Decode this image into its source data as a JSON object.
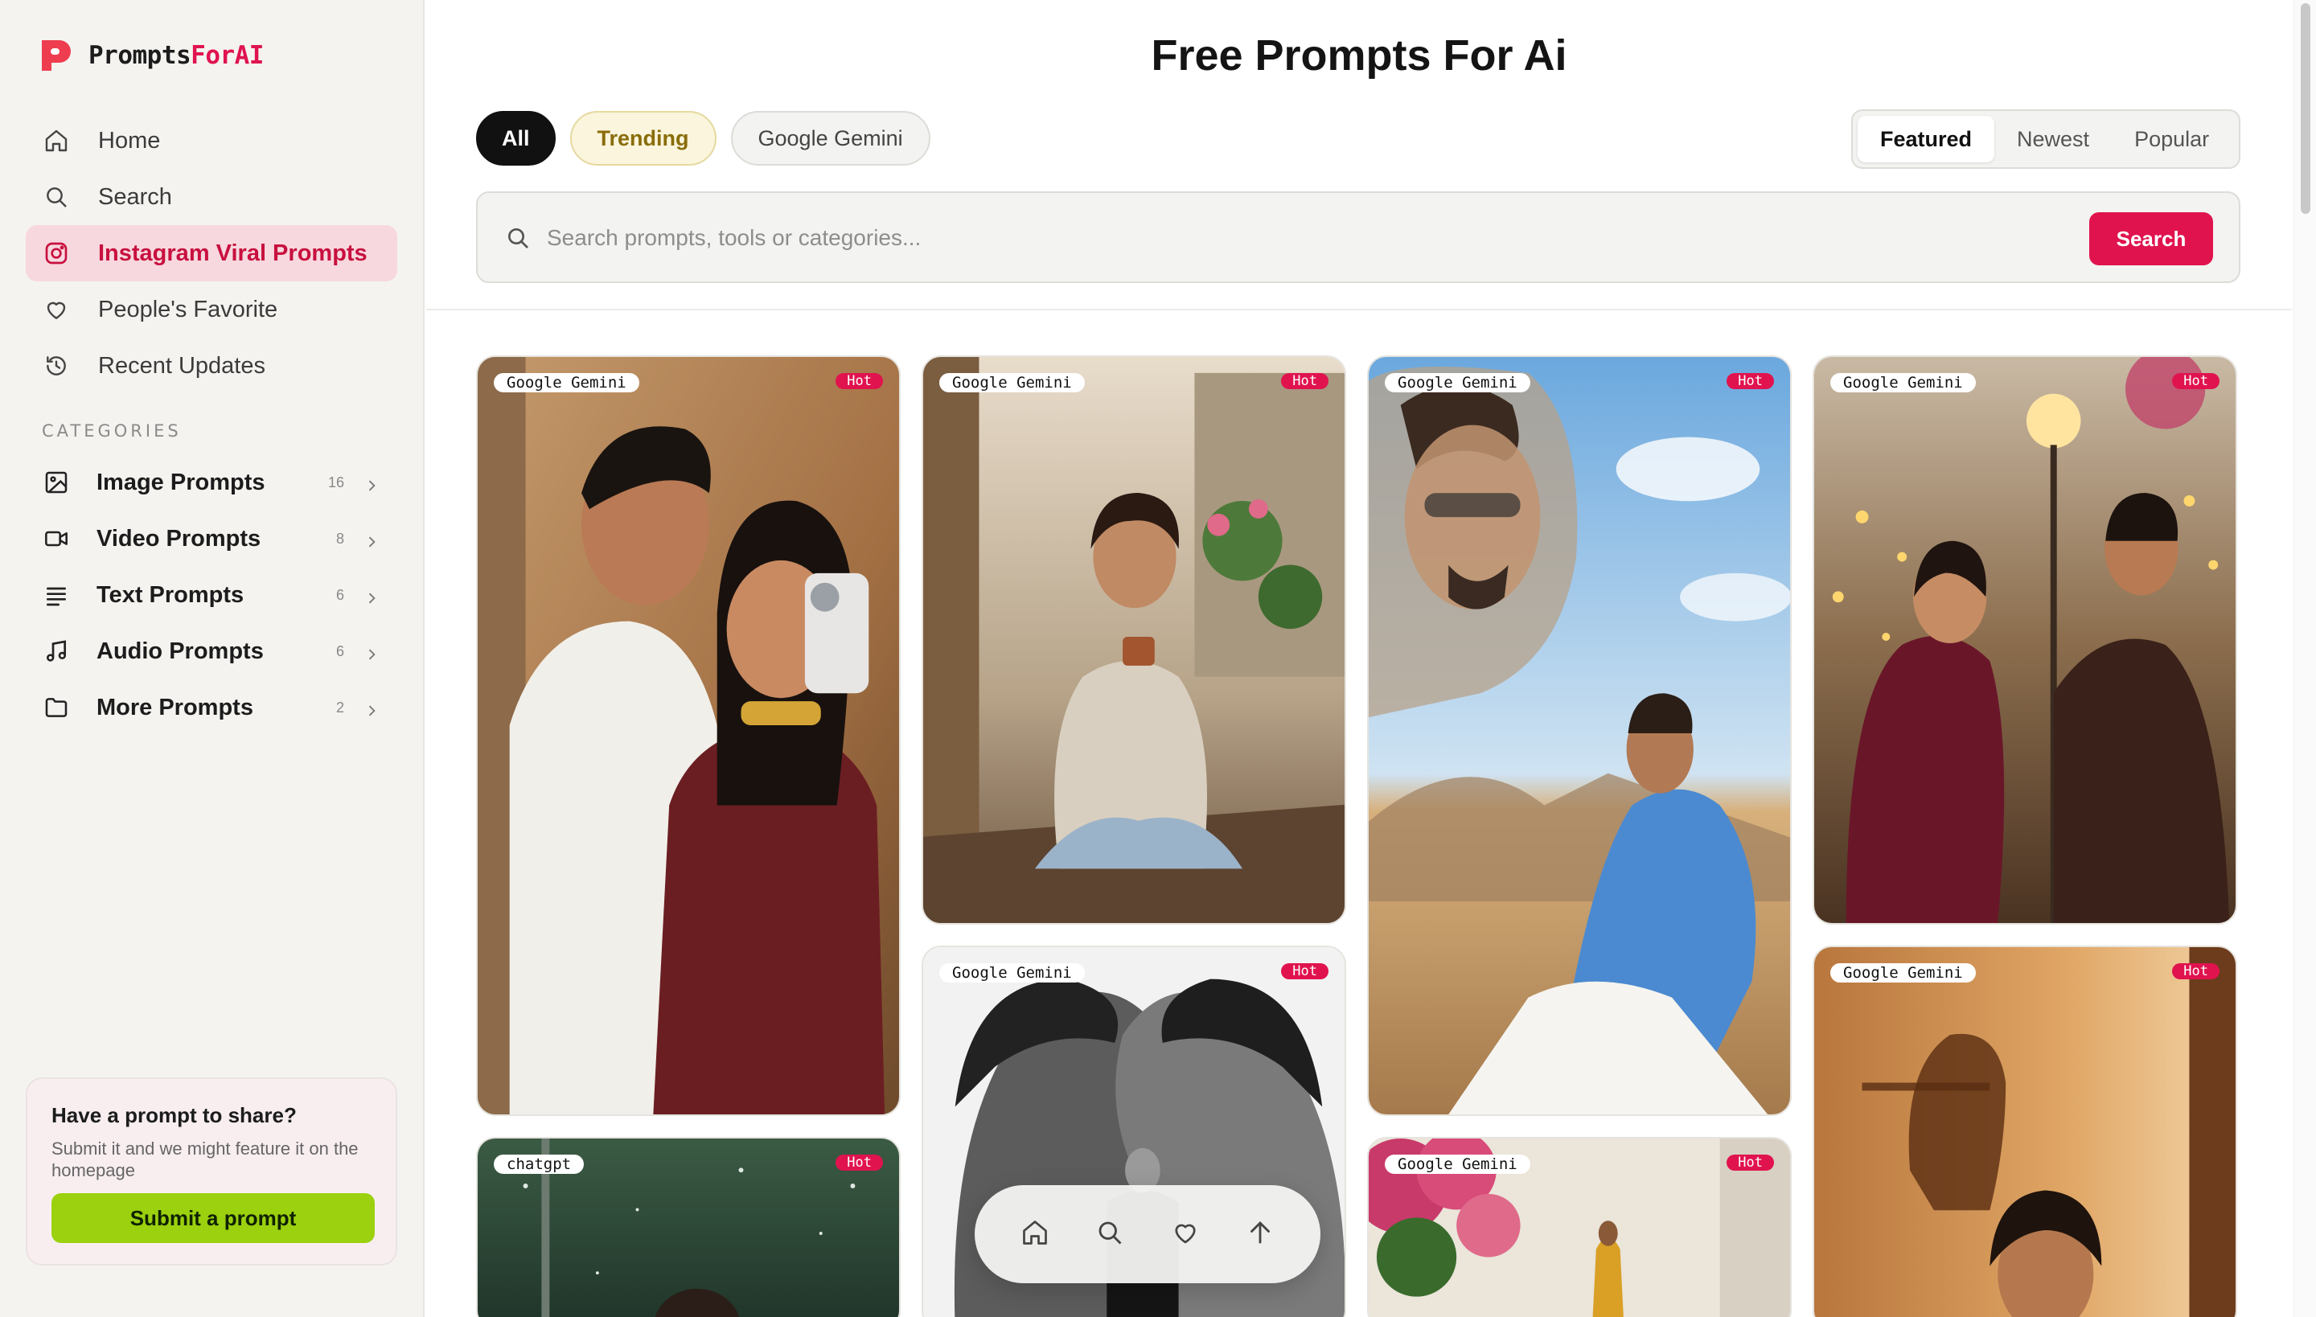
{
  "brand": {
    "name_part1": "Prompts",
    "name_part2": "ForAI",
    "accent_color": "#e0134f"
  },
  "nav": [
    {
      "label": "Home",
      "icon": "home-icon"
    },
    {
      "label": "Search",
      "icon": "search-icon"
    },
    {
      "label": "Instagram Viral Prompts",
      "icon": "instagram-icon",
      "active": true
    },
    {
      "label": "People's Favorite",
      "icon": "heart-icon"
    },
    {
      "label": "Recent Updates",
      "icon": "history-icon"
    }
  ],
  "categories_title": "CATEGORIES",
  "categories": [
    {
      "label": "Image Prompts",
      "count": "16",
      "icon": "image-icon"
    },
    {
      "label": "Video Prompts",
      "count": "8",
      "icon": "video-icon"
    },
    {
      "label": "Text Prompts",
      "count": "6",
      "icon": "text-lines-icon"
    },
    {
      "label": "Audio Prompts",
      "count": "6",
      "icon": "music-note-icon"
    },
    {
      "label": "More Prompts",
      "count": "2",
      "icon": "folder-icon"
    }
  ],
  "share": {
    "title": "Have a prompt to share?",
    "description": "Submit it and we might feature it on the homepage",
    "button": "Submit a prompt",
    "button_color": "#9bd10f"
  },
  "page_title": "Free Prompts For Ai",
  "filters": [
    "All",
    "Trending",
    "Google Gemini"
  ],
  "sort_tabs": [
    "Featured",
    "Newest",
    "Popular"
  ],
  "sort_selected": "Featured",
  "search": {
    "placeholder": "Search prompts, tools or categories...",
    "button": "Search"
  },
  "cards": [
    {
      "tag": "Google Gemini",
      "badge": "Hot",
      "subject": "couple selfie indoors"
    },
    {
      "tag": "chatgpt",
      "badge": "Hot",
      "subject": "woman in rain"
    },
    {
      "tag": "Google Gemini",
      "badge": "Hot",
      "subject": "woman with tea on balcony"
    },
    {
      "tag": "Google Gemini",
      "badge": "Hot",
      "subject": "double exposure monochrome portrait"
    },
    {
      "tag": "Google Gemini",
      "badge": "Hot",
      "subject": "man in blue blazer in desert"
    },
    {
      "tag": "Google Gemini",
      "badge": "Hot",
      "subject": "woman by flower wall"
    },
    {
      "tag": "Google Gemini",
      "badge": "Hot",
      "subject": "couple dancing with lights"
    },
    {
      "tag": "Google Gemini",
      "badge": "Hot",
      "subject": "woman with shadow silhouette"
    }
  ],
  "dock": [
    "home-icon",
    "search-icon",
    "heart-icon",
    "arrow-up-icon"
  ]
}
